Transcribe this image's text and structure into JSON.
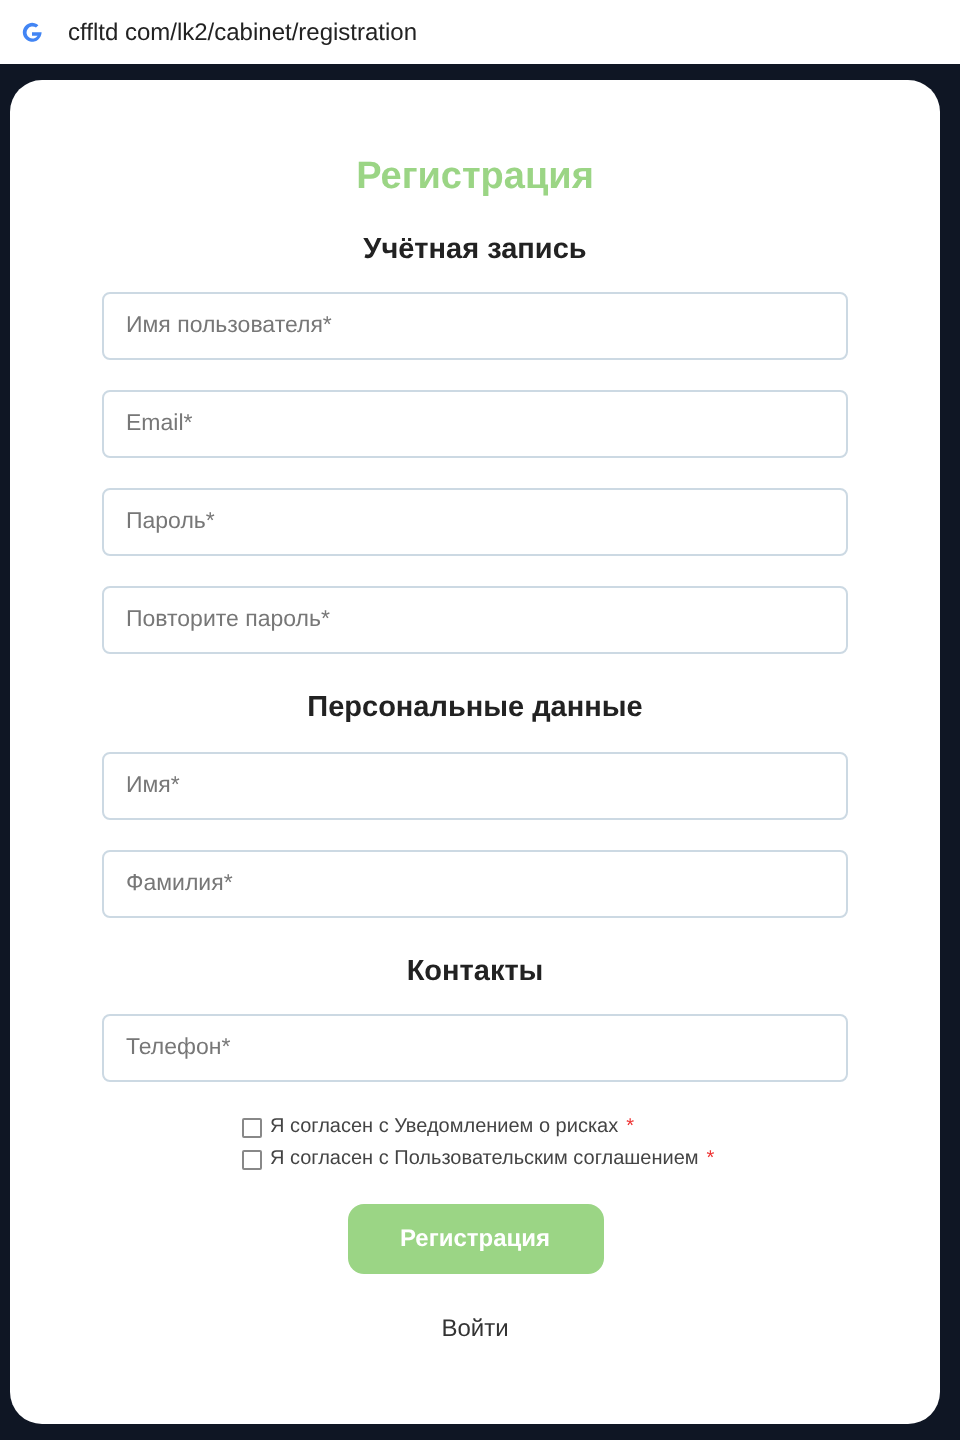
{
  "address_bar": {
    "url": "cffltd com/lk2/cabinet/registration"
  },
  "form": {
    "title": "Регистрация",
    "sections": [
      {
        "heading": "Учётная запись",
        "fields": [
          {
            "placeholder": "Имя пользователя*"
          },
          {
            "placeholder": "Email*"
          },
          {
            "placeholder": "Пароль*"
          },
          {
            "placeholder": "Повторите пароль*"
          }
        ]
      },
      {
        "heading": "Персональные данные",
        "fields": [
          {
            "placeholder": "Имя*"
          },
          {
            "placeholder": "Фамилия*"
          }
        ]
      },
      {
        "heading": "Контакты",
        "fields": [
          {
            "placeholder": "Телефон*"
          }
        ]
      }
    ],
    "agreements": [
      {
        "label": "Я согласен с Уведомлением о рисках",
        "required_mark": "*",
        "checked": false
      },
      {
        "label": "Я согласен с Пользовательским соглашением",
        "required_mark": "*",
        "checked": false
      }
    ],
    "submit_button": "Регистрация",
    "login_link": "Войти"
  }
}
